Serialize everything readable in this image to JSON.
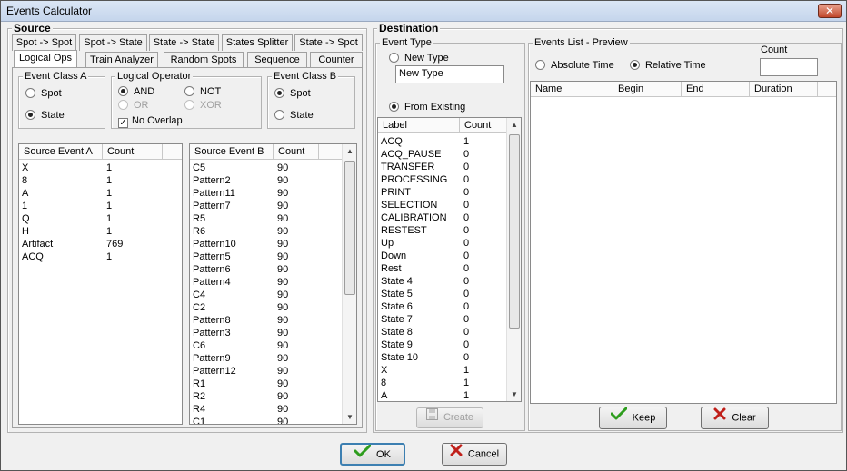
{
  "window": {
    "title": "Events Calculator",
    "close": "✕"
  },
  "source": {
    "label": "Source",
    "tabs_row1": [
      "Spot -> Spot",
      "Spot -> State",
      "State -> State",
      "States Splitter",
      "State -> Spot"
    ],
    "tabs_row2": [
      "Logical Ops",
      "Train Analyzer",
      "Random Spots",
      "Sequence",
      "Counter"
    ],
    "class_a": {
      "label": "Event Class A",
      "spot": "Spot",
      "state": "State"
    },
    "logical": {
      "label": "Logical Operator",
      "and": "AND",
      "not": "NOT",
      "or": "OR",
      "xor": "XOR",
      "no_overlap": "No Overlap"
    },
    "class_b": {
      "label": "Event Class B",
      "spot": "Spot",
      "state": "State"
    },
    "list_a": {
      "headers": [
        "Source Event A",
        "Count"
      ],
      "rows": [
        [
          "X",
          "1"
        ],
        [
          "8",
          "1"
        ],
        [
          "A",
          "1"
        ],
        [
          "1",
          "1"
        ],
        [
          "Q",
          "1"
        ],
        [
          "H",
          "1"
        ],
        [
          "Artifact",
          "769"
        ],
        [
          "ACQ",
          "1"
        ]
      ]
    },
    "list_b": {
      "headers": [
        "Source Event B",
        "Count"
      ],
      "rows": [
        [
          "C5",
          "90"
        ],
        [
          "Pattern2",
          "90"
        ],
        [
          "Pattern11",
          "90"
        ],
        [
          "Pattern7",
          "90"
        ],
        [
          "R5",
          "90"
        ],
        [
          "R6",
          "90"
        ],
        [
          "Pattern10",
          "90"
        ],
        [
          "Pattern5",
          "90"
        ],
        [
          "Pattern6",
          "90"
        ],
        [
          "Pattern4",
          "90"
        ],
        [
          "C4",
          "90"
        ],
        [
          "C2",
          "90"
        ],
        [
          "Pattern8",
          "90"
        ],
        [
          "Pattern3",
          "90"
        ],
        [
          "C6",
          "90"
        ],
        [
          "Pattern9",
          "90"
        ],
        [
          "Pattern12",
          "90"
        ],
        [
          "R1",
          "90"
        ],
        [
          "R2",
          "90"
        ],
        [
          "R4",
          "90"
        ],
        [
          "C1",
          "90"
        ]
      ]
    }
  },
  "destination": {
    "label": "Destination",
    "event_type": {
      "label": "Event Type",
      "new_type": "New Type",
      "new_type_value": "New Type",
      "from_existing": "From Existing",
      "headers": [
        "Label",
        "Count"
      ],
      "rows": [
        [
          "ACQ",
          "1"
        ],
        [
          "ACQ_PAUSE",
          "0"
        ],
        [
          "TRANSFER",
          "0"
        ],
        [
          "PROCESSING",
          "0"
        ],
        [
          "PRINT",
          "0"
        ],
        [
          "SELECTION",
          "0"
        ],
        [
          "CALIBRATION",
          "0"
        ],
        [
          "RESTEST",
          "0"
        ],
        [
          "Up",
          "0"
        ],
        [
          "Down",
          "0"
        ],
        [
          "Rest",
          "0"
        ],
        [
          "State 4",
          "0"
        ],
        [
          "State 5",
          "0"
        ],
        [
          "State 6",
          "0"
        ],
        [
          "State 7",
          "0"
        ],
        [
          "State 8",
          "0"
        ],
        [
          "State 9",
          "0"
        ],
        [
          "State 10",
          "0"
        ],
        [
          "X",
          "1"
        ],
        [
          "8",
          "1"
        ],
        [
          "A",
          "1"
        ]
      ],
      "create": "Create"
    },
    "preview": {
      "label": "Events List - Preview",
      "absolute": "Absolute Time",
      "relative": "Relative Time",
      "count_label": "Count",
      "count_value": "",
      "headers": [
        "Name",
        "Begin",
        "End",
        "Duration"
      ],
      "keep": "Keep",
      "clear": "Clear"
    }
  },
  "footer": {
    "ok": "OK",
    "cancel": "Cancel"
  },
  "colors": {
    "check_green": "#2e9d1e",
    "cross_red": "#c0201a"
  }
}
